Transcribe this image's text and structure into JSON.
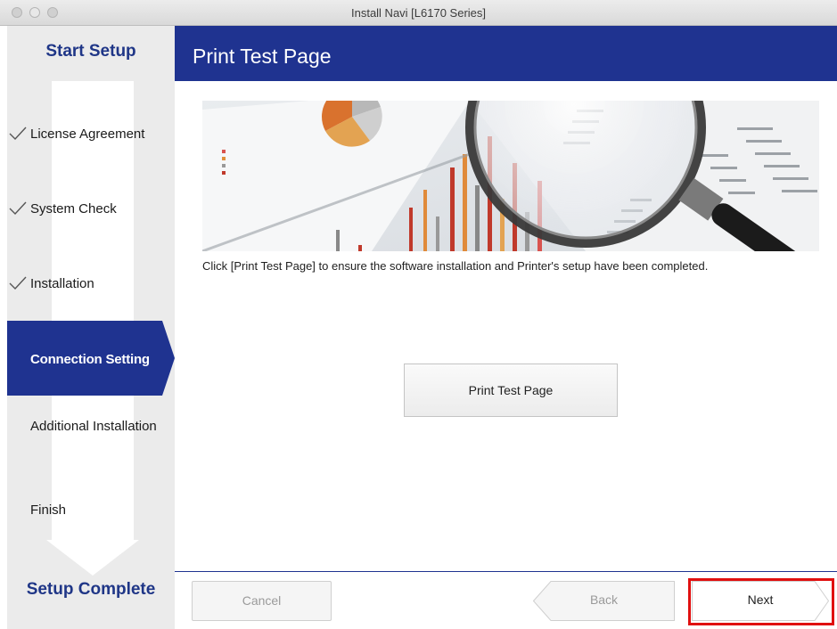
{
  "window": {
    "title": "Install Navi [L6170 Series]"
  },
  "sidebar": {
    "top_title": "Start Setup",
    "bottom_title": "Setup Complete",
    "steps": [
      {
        "label": "License Agreement",
        "status": "done"
      },
      {
        "label": "System Check",
        "status": "done"
      },
      {
        "label": "Installation",
        "status": "done"
      },
      {
        "label": "Connection Setting",
        "status": "active"
      },
      {
        "label": "Additional Installation",
        "status": "pending"
      },
      {
        "label": "Finish",
        "status": "pending"
      }
    ]
  },
  "header": {
    "title": "Print Test Page"
  },
  "main": {
    "description": "Click [Print Test Page] to ensure the software installation and Printer's setup have been completed.",
    "print_button_label": "Print Test Page"
  },
  "footer": {
    "cancel_label": "Cancel",
    "back_label": "Back",
    "next_label": "Next"
  },
  "colors": {
    "brand_blue": "#1f3390",
    "sidebar_title": "#1f3687",
    "highlight": "#e01010"
  }
}
